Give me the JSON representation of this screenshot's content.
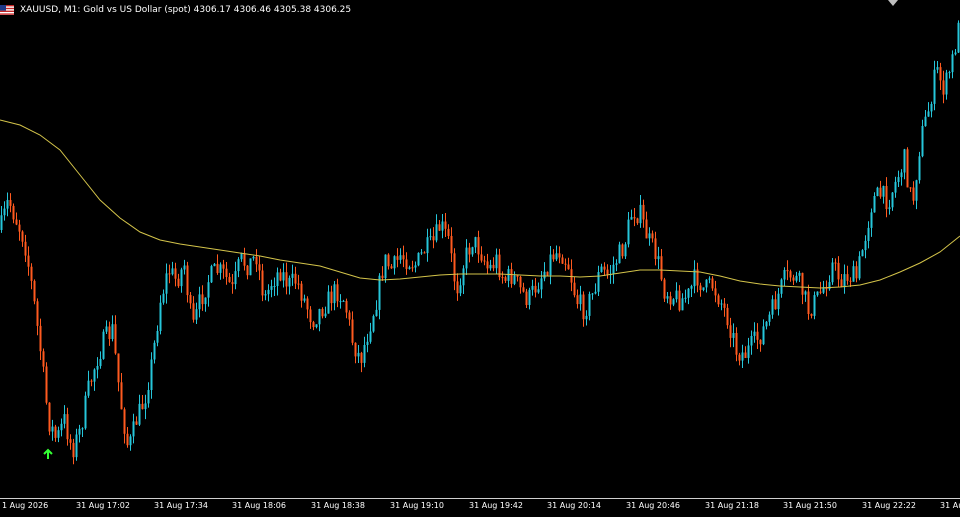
{
  "header": {
    "symbol_line": "XAUUSD, M1:  Gold vs US Dollar (spot)  4306.17 4306.46 4305.38 4306.25",
    "flag_icon": "us-flag-icon"
  },
  "colors": {
    "background": "#000000",
    "bull": "#26c6da",
    "bear": "#ff5a1f",
    "ma": "#d4c44a",
    "arrow": "#33ff33",
    "text": "#ffffff",
    "axis": "#d0d0d0"
  },
  "chart_data": {
    "type": "candlestick",
    "title": "XAUUSD, M1:  Gold vs US Dollar (spot)",
    "last_ohlc": {
      "open": 4306.17,
      "high": 4306.46,
      "low": 4305.38,
      "close": 4306.25
    },
    "x_ticks": [
      "1 Aug 2026",
      "31 Aug 17:02",
      "31 Aug 17:34",
      "31 Aug 18:06",
      "31 Aug 18:38",
      "31 Aug 19:10",
      "31 Aug 19:42",
      "31 Aug 20:14",
      "31 Aug 20:46",
      "31 Aug 21:18",
      "31 Aug 21:50",
      "31 Aug 22:22",
      "31 Au"
    ],
    "grid": false,
    "y_axis_labels": "none",
    "close_path": [
      [
        0,
        230
      ],
      [
        8,
        200
      ],
      [
        16,
        220
      ],
      [
        24,
        240
      ],
      [
        32,
        290
      ],
      [
        40,
        350
      ],
      [
        48,
        420
      ],
      [
        56,
        440
      ],
      [
        64,
        420
      ],
      [
        72,
        450
      ],
      [
        80,
        430
      ],
      [
        88,
        390
      ],
      [
        96,
        360
      ],
      [
        104,
        340
      ],
      [
        112,
        330
      ],
      [
        120,
        400
      ],
      [
        128,
        450
      ],
      [
        136,
        420
      ],
      [
        144,
        400
      ],
      [
        152,
        360
      ],
      [
        160,
        300
      ],
      [
        168,
        270
      ],
      [
        176,
        280
      ],
      [
        184,
        265
      ],
      [
        192,
        330
      ],
      [
        200,
        300
      ],
      [
        208,
        280
      ],
      [
        216,
        270
      ],
      [
        224,
        275
      ],
      [
        232,
        290
      ],
      [
        240,
        260
      ],
      [
        248,
        265
      ],
      [
        256,
        255
      ],
      [
        264,
        300
      ],
      [
        272,
        280
      ],
      [
        280,
        270
      ],
      [
        288,
        285
      ],
      [
        296,
        280
      ],
      [
        304,
        300
      ],
      [
        312,
        320
      ],
      [
        320,
        310
      ],
      [
        328,
        300
      ],
      [
        336,
        290
      ],
      [
        344,
        300
      ],
      [
        352,
        340
      ],
      [
        360,
        360
      ],
      [
        368,
        330
      ],
      [
        376,
        300
      ],
      [
        384,
        260
      ],
      [
        392,
        270
      ],
      [
        400,
        255
      ],
      [
        408,
        260
      ],
      [
        416,
        265
      ],
      [
        424,
        250
      ],
      [
        432,
        245
      ],
      [
        440,
        225
      ],
      [
        448,
        240
      ],
      [
        456,
        290
      ],
      [
        464,
        260
      ],
      [
        472,
        240
      ],
      [
        480,
        250
      ],
      [
        488,
        270
      ],
      [
        496,
        260
      ],
      [
        504,
        280
      ],
      [
        512,
        275
      ],
      [
        520,
        290
      ],
      [
        528,
        300
      ],
      [
        536,
        285
      ],
      [
        544,
        270
      ],
      [
        552,
        255
      ],
      [
        560,
        250
      ],
      [
        568,
        265
      ],
      [
        576,
        300
      ],
      [
        584,
        310
      ],
      [
        592,
        295
      ],
      [
        600,
        270
      ],
      [
        608,
        275
      ],
      [
        616,
        260
      ],
      [
        624,
        245
      ],
      [
        632,
        210
      ],
      [
        640,
        215
      ],
      [
        648,
        240
      ],
      [
        656,
        255
      ],
      [
        664,
        290
      ],
      [
        672,
        295
      ],
      [
        680,
        300
      ],
      [
        688,
        295
      ],
      [
        696,
        275
      ],
      [
        704,
        290
      ],
      [
        712,
        285
      ],
      [
        720,
        300
      ],
      [
        728,
        320
      ],
      [
        736,
        350
      ],
      [
        744,
        355
      ],
      [
        752,
        345
      ],
      [
        760,
        335
      ],
      [
        768,
        320
      ],
      [
        776,
        300
      ],
      [
        784,
        280
      ],
      [
        792,
        275
      ],
      [
        800,
        285
      ],
      [
        808,
        310
      ],
      [
        816,
        300
      ],
      [
        824,
        285
      ],
      [
        832,
        265
      ],
      [
        840,
        280
      ],
      [
        848,
        275
      ],
      [
        856,
        278
      ],
      [
        864,
        240
      ],
      [
        872,
        200
      ],
      [
        880,
        195
      ],
      [
        888,
        200
      ],
      [
        896,
        180
      ],
      [
        904,
        160
      ],
      [
        912,
        205
      ],
      [
        920,
        140
      ],
      [
        928,
        110
      ],
      [
        936,
        70
      ],
      [
        944,
        90
      ],
      [
        952,
        60
      ],
      [
        960,
        20
      ]
    ],
    "ma_path": [
      [
        0,
        120
      ],
      [
        20,
        125
      ],
      [
        40,
        135
      ],
      [
        60,
        150
      ],
      [
        80,
        175
      ],
      [
        100,
        200
      ],
      [
        120,
        218
      ],
      [
        140,
        232
      ],
      [
        160,
        240
      ],
      [
        180,
        244
      ],
      [
        200,
        247
      ],
      [
        220,
        250
      ],
      [
        240,
        253
      ],
      [
        260,
        256
      ],
      [
        280,
        260
      ],
      [
        300,
        263
      ],
      [
        320,
        266
      ],
      [
        340,
        272
      ],
      [
        360,
        278
      ],
      [
        380,
        280
      ],
      [
        400,
        279
      ],
      [
        420,
        277
      ],
      [
        440,
        275
      ],
      [
        460,
        274
      ],
      [
        480,
        274
      ],
      [
        500,
        274
      ],
      [
        520,
        275
      ],
      [
        540,
        276
      ],
      [
        560,
        276
      ],
      [
        580,
        277
      ],
      [
        600,
        276
      ],
      [
        620,
        273
      ],
      [
        640,
        270
      ],
      [
        660,
        270
      ],
      [
        680,
        271
      ],
      [
        700,
        272
      ],
      [
        720,
        276
      ],
      [
        740,
        281
      ],
      [
        760,
        284
      ],
      [
        780,
        286
      ],
      [
        800,
        287
      ],
      [
        820,
        288
      ],
      [
        840,
        287
      ],
      [
        860,
        285
      ],
      [
        880,
        280
      ],
      [
        900,
        272
      ],
      [
        920,
        263
      ],
      [
        940,
        252
      ],
      [
        960,
        236
      ]
    ],
    "signal_arrows": [
      {
        "x_index": 6,
        "direction": "up"
      }
    ]
  }
}
